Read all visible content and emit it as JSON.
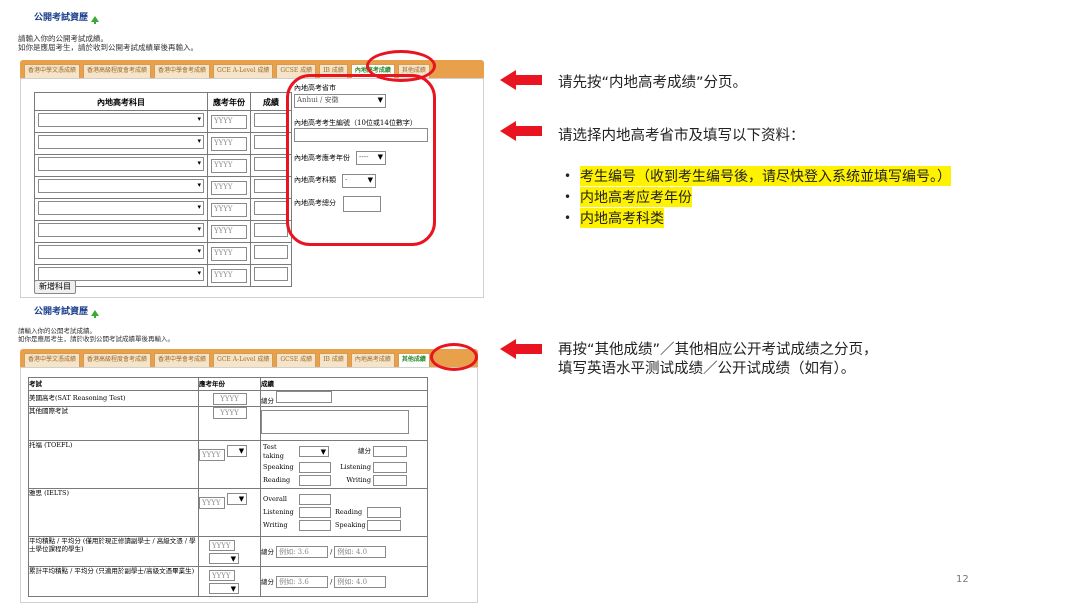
{
  "panel1": {
    "title": "公開考試資歷",
    "intro_line1": "請輸入你的公開考試成績。",
    "intro_line2": "如你是應屆考生，請於收到公開考試成績單後再輸入。",
    "tabs": [
      "香港中學文憑成績",
      "香港高級程度會考成績",
      "香港中學會考成績",
      "GCE A-Level 成績",
      "GCSE 成績",
      "IB 成績",
      "內地高考成績",
      "其他成績"
    ],
    "active_tab": "內地高考成績",
    "table": {
      "col_subject": "內地高考科目",
      "col_year": "應考年份",
      "col_score": "成績",
      "year_placeholder": "YYYY",
      "rows": 8
    },
    "form": {
      "province_label": "內地高考省市",
      "province_value": "Anhui / 安徽",
      "candidate_no_label": "內地高考考生編號（10位或14位數字）",
      "exam_year_label": "內地高考應考年份",
      "exam_year_value": "----",
      "stream_label": "內地高考科類",
      "stream_value": "-",
      "total_label": "內地高考總分"
    },
    "add_subject_button": "新增科目"
  },
  "panel2": {
    "title": "公開考試資歷",
    "intro_line1": "請輸入你的公開考試成績。",
    "intro_line2": "如你是應屆考生，請於收到公開考試成績單後再輸入。",
    "tabs": [
      "香港中學文憑成績",
      "香港高級程度會考成績",
      "香港中學會考成績",
      "GCE A-Level 成績",
      "GCSE 成績",
      "IB 成績",
      "內地高考成績",
      "其他成績"
    ],
    "active_tab": "其他成績",
    "headers": {
      "exam": "考試",
      "year": "應考年份",
      "score": "成績"
    },
    "rows": {
      "sat": "美國高考(SAT Reasoning Test)",
      "other": "其他國際考試",
      "toefl": "托福 (TOEFL)",
      "ielts": "雅思 (IELTS)",
      "gpa": "平均積點 / 平均分 (僅用於現正修讀副學士 / 高級文憑 / 學士學位課程的學生)",
      "cgpa": "累計平均積點 / 平均分 (只適用於副學士/高級文憑畢業生)"
    },
    "labels": {
      "total": "總分",
      "test_taking": "Test taking",
      "speaking": "Speaking",
      "listening": "Listening",
      "reading": "Reading",
      "writing": "Writing",
      "overall": "Overall",
      "yyyy": "YYYY",
      "ex_36": "例如: 3.6",
      "ex_40": "例如: 4.0"
    }
  },
  "annotations": {
    "step1": "请先按“内地高考成绩”分页。",
    "step2": "请选择内地高考省市及填写以下资料：",
    "bullets": [
      "考生编号（收到考生编号後，请尽快登入系统並填写编号。）",
      "内地高考应考年份",
      "内地高考科类"
    ],
    "step3_line1": "再按“其他成绩”／其他相应公开考试成绩之分页，",
    "step3_line2": "填写英语水平测试成绩／公开试成绩（如有）。"
  },
  "page_number": "12",
  "colors": {
    "accent_red": "#e8141f",
    "tab_orange": "#e8a14a",
    "highlight": "#fff200",
    "title_blue": "#1a3e8c",
    "active_green": "#2d8a2d"
  }
}
